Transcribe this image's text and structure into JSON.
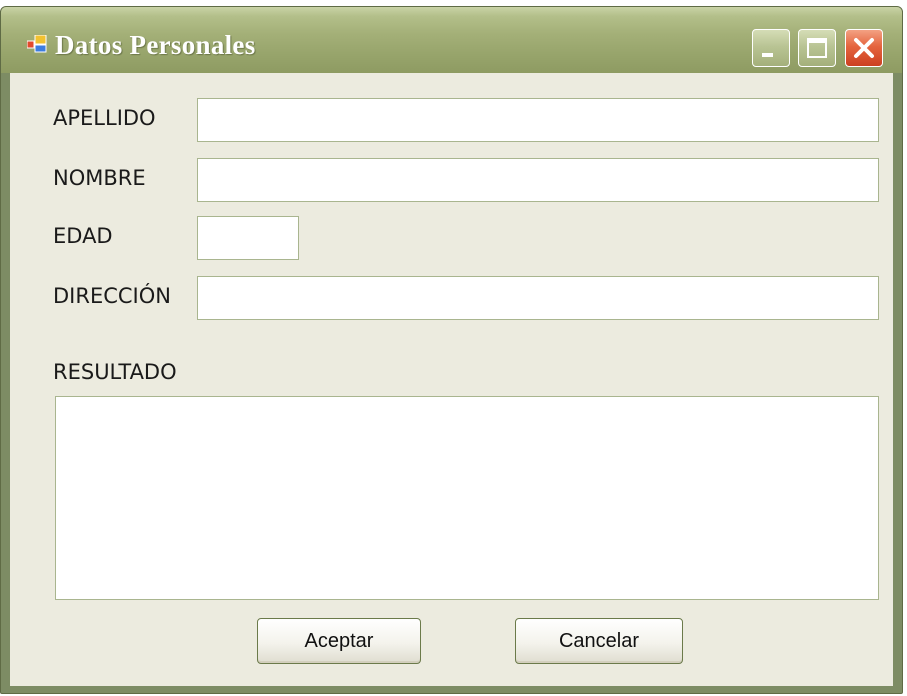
{
  "window": {
    "title": "Datos Personales",
    "icon": "form-app-icon"
  },
  "controls": {
    "minimize": "minimize-icon",
    "maximize": "maximize-icon",
    "close": "close-icon"
  },
  "form": {
    "apellido_label": "APELLIDO",
    "apellido_value": "",
    "nombre_label": "NOMBRE",
    "nombre_value": "",
    "edad_label": "EDAD",
    "edad_value": "",
    "direccion_label": "DIRECCIÓN",
    "direccion_value": "",
    "resultado_label": "RESULTADO",
    "resultado_value": ""
  },
  "buttons": {
    "accept_label": "Aceptar",
    "cancel_label": "Cancelar"
  },
  "colors": {
    "titlebar": "#98a56c",
    "client_background": "#ecebdf",
    "close_button": "#e5653f"
  }
}
